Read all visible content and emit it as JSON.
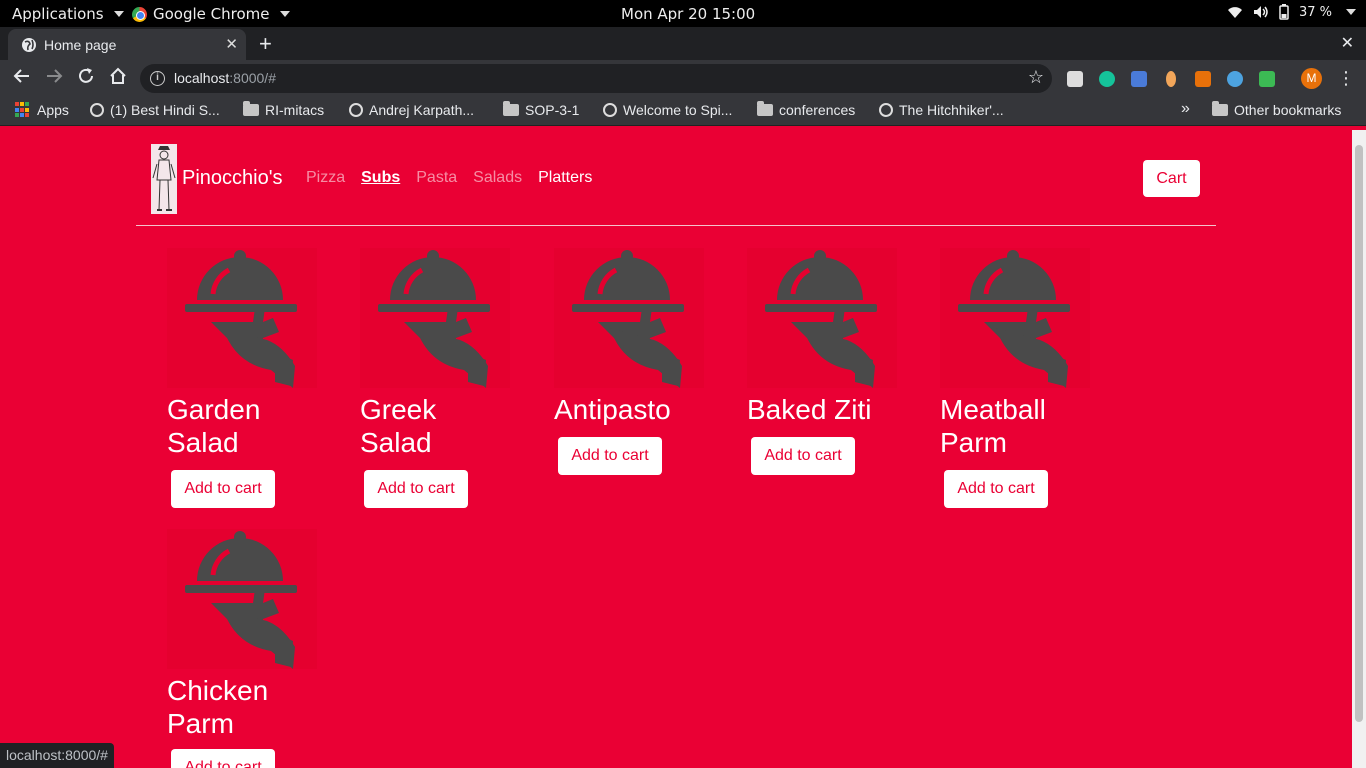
{
  "desktop": {
    "applications_label": "Applications",
    "chrome_label": "Google Chrome",
    "clock": "Mon Apr 20  15:00",
    "battery": "37 %"
  },
  "browser": {
    "tab_title": "Home page",
    "url_host": "localhost",
    "url_rest": ":8000/#",
    "status_url": "localhost:8000/#",
    "avatar_letter": "M"
  },
  "bookmarks": [
    {
      "label": "Apps",
      "icon": "apps-grid-icon"
    },
    {
      "label": "(1) Best Hindi S...",
      "icon": "globe-icon"
    },
    {
      "label": "RI-mitacs",
      "icon": "folder-icon"
    },
    {
      "label": "Andrej Karpath...",
      "icon": "globe-icon"
    },
    {
      "label": "SOP-3-1",
      "icon": "folder-icon"
    },
    {
      "label": "Welcome to Spi...",
      "icon": "openai-icon"
    },
    {
      "label": "conferences",
      "icon": "folder-icon"
    },
    {
      "label": "The Hitchhiker'...",
      "icon": "globe-icon"
    }
  ],
  "bookmarks_overflow": "»",
  "other_bookmarks": "Other bookmarks",
  "site": {
    "brand": "Pinocchio's",
    "nav": [
      "Pizza",
      "Subs",
      "Pasta",
      "Salads",
      "Platters"
    ],
    "active_nav": "Subs",
    "cart_label": "Cart"
  },
  "menu_items": [
    {
      "name": "Garden Salad",
      "button": "Add to cart"
    },
    {
      "name": "Greek Salad",
      "button": "Add to cart"
    },
    {
      "name": "Antipasto",
      "button": "Add to cart"
    },
    {
      "name": "Baked Ziti",
      "button": "Add to cart"
    },
    {
      "name": "Meatball Parm",
      "button": "Add to cart"
    },
    {
      "name": "Chicken Parm",
      "button": "Add to cart"
    }
  ],
  "colors": {
    "page_bg": "#ea0034",
    "icon_gray": "#4a4a4a"
  }
}
